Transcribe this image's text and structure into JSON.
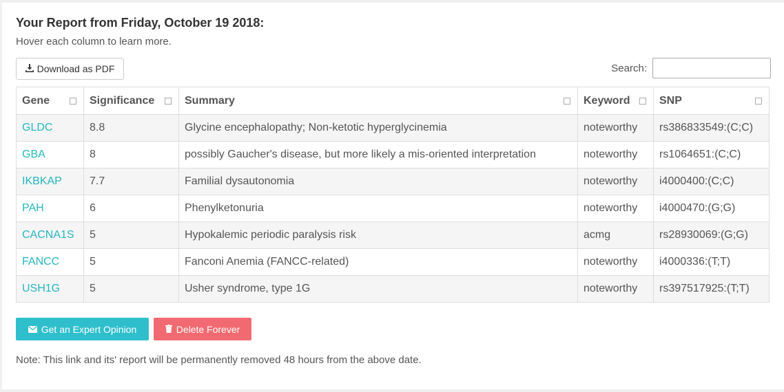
{
  "header": {
    "title": "Your Report from Friday, October 19 2018:",
    "subtitle": "Hover each column to learn more."
  },
  "toolbar": {
    "download_label": "Download as PDF",
    "download_icon": "download-icon",
    "search_label": "Search:",
    "search_value": ""
  },
  "table": {
    "columns": [
      "Gene",
      "Significance",
      "Summary",
      "Keyword",
      "SNP"
    ],
    "rows": [
      {
        "gene": "GLDC",
        "significance": "8.8",
        "summary": "Glycine encephalopathy; Non-ketotic hyperglycinemia",
        "keyword": "noteworthy",
        "snp": "rs386833549:(C;C)"
      },
      {
        "gene": "GBA",
        "significance": "8",
        "summary": "possibly Gaucher's disease, but more likely a mis-oriented interpretation",
        "keyword": "noteworthy",
        "snp": "rs1064651:(C;C)"
      },
      {
        "gene": "IKBKAP",
        "significance": "7.7",
        "summary": "Familial dysautonomia",
        "keyword": "noteworthy",
        "snp": "i4000400:(C;C)"
      },
      {
        "gene": "PAH",
        "significance": "6",
        "summary": "Phenylketonuria",
        "keyword": "noteworthy",
        "snp": "i4000470:(G;G)"
      },
      {
        "gene": "CACNA1S",
        "significance": "5",
        "summary": "Hypokalemic periodic paralysis risk",
        "keyword": "acmg",
        "snp": "rs28930069:(G;G)"
      },
      {
        "gene": "FANCC",
        "significance": "5",
        "summary": "Fanconi Anemia (FANCC-related)",
        "keyword": "noteworthy",
        "snp": "i4000336:(T;T)"
      },
      {
        "gene": "USH1G",
        "significance": "5",
        "summary": "Usher syndrome, type 1G",
        "keyword": "noteworthy",
        "snp": "rs397517925:(T;T)"
      }
    ]
  },
  "actions": {
    "expert_label": "Get an Expert Opinion",
    "expert_icon": "envelope-icon",
    "delete_label": "Delete Forever",
    "delete_icon": "trash-icon",
    "expert_color": "#2fbfcc",
    "delete_color": "#f26a71"
  },
  "footer": {
    "note": "Note: This link and its' report will be permanently removed 48 hours from the above date."
  },
  "colors": {
    "link": "#26b6bf"
  }
}
